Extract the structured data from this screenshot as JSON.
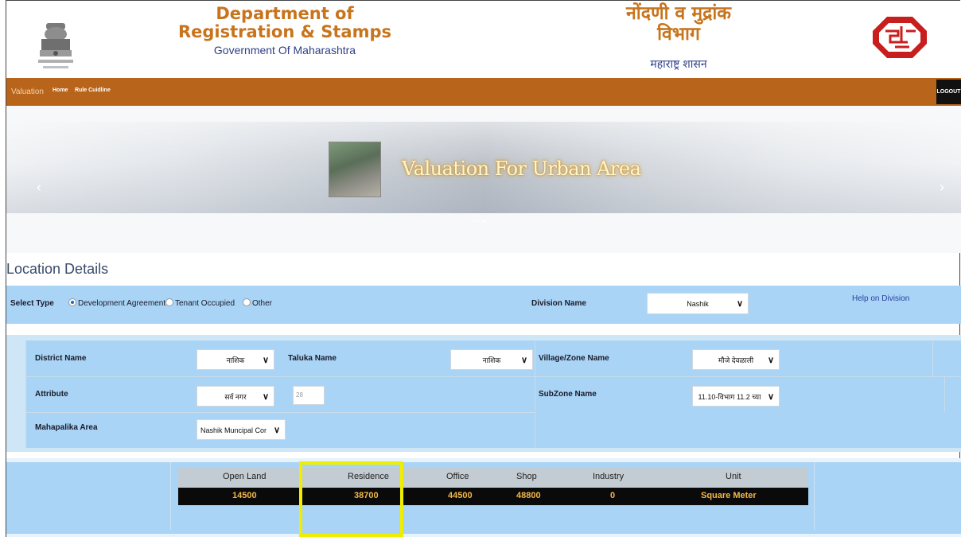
{
  "header": {
    "title_en_line1": "Department of",
    "title_en_line2": "Registration & Stamps",
    "gov_en": "Government Of Maharashtra",
    "title_mr_line1": "नोंदणी व मुद्रांक",
    "title_mr_line2": "विभाग",
    "gov_mr": "महाराष्ट्र शासन",
    "emblem_icon": "ashoka-emblem-icon",
    "logo_icon": "igr-logo-icon"
  },
  "nav": {
    "brand": "Valuation",
    "links": [
      "Home",
      "Rule Cuidline"
    ],
    "logout": "LOGOUT"
  },
  "banner": {
    "title": "Valuation For Urban Area",
    "prev": "‹",
    "next": "›",
    "dots": "○○●○"
  },
  "location": {
    "title": "Location Details",
    "select_type_label": "Select Type",
    "types": [
      "Development Agreement",
      "Tenant Occupied",
      "Other"
    ],
    "selected_type": "Development Agreement",
    "division_label": "Division Name",
    "division_value": "Nashik",
    "help_link": "Help on Division",
    "district_label": "District Name",
    "district_value": "नाशिक",
    "taluka_label": "Taluka Name",
    "taluka_value": "नाशिक",
    "village_label": "Village/Zone Name",
    "village_value": "मौजे देवळाली",
    "attribute_label": "Attribute",
    "attribute_value": "सर्व नगर",
    "attribute_input": "28",
    "subzone_label": "SubZone Name",
    "subzone_value": "11.10-विभाग 11.2 च्या",
    "mahapalika_label": "Mahapalika Area",
    "mahapalika_value": "Nashik Muncipal Cor"
  },
  "rates": {
    "headers": [
      "Open Land",
      "Residence",
      "Office",
      "Shop",
      "Industry",
      "Unit"
    ],
    "values": [
      "14500",
      "38700",
      "44500",
      "48800",
      "0",
      "Square Meter"
    ]
  },
  "colors": {
    "nav_bar": "#b8651b",
    "form_bg": "#a9d4f5",
    "title_orange": "#c8741c",
    "highlight": "#f0ee00",
    "rate_text": "#f3b84a"
  }
}
